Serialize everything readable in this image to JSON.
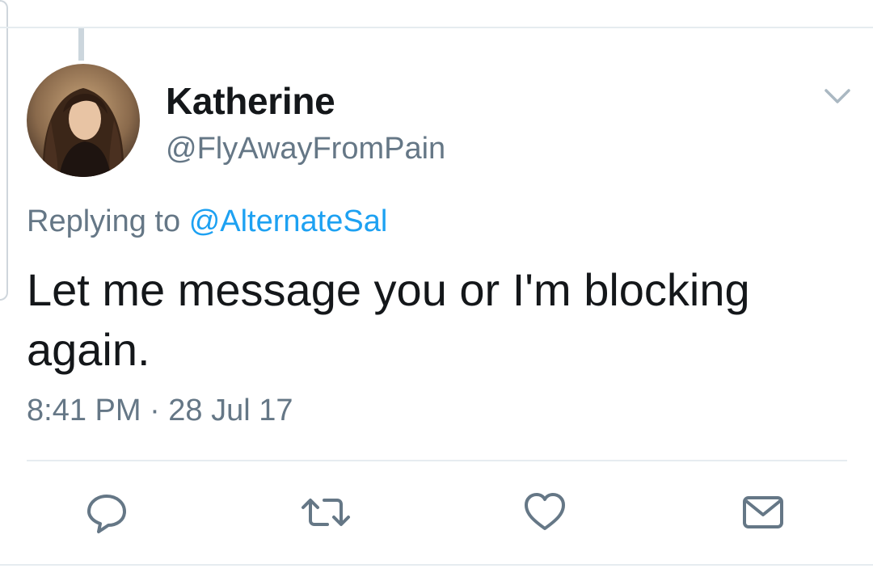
{
  "tweet": {
    "author": {
      "display_name": "Katherine",
      "handle": "@FlyAwayFromPain",
      "avatar_icon": "profile-photo"
    },
    "reply_prefix": "Replying to",
    "reply_to_handle": "@AlternateSal",
    "text": "Let me message you or I'm blocking again.",
    "timestamp": "8:41 PM · 28 Jul 17"
  },
  "actions": [
    {
      "name": "reply",
      "icon": "speech-bubble-icon"
    },
    {
      "name": "retweet",
      "icon": "retweet-icon"
    },
    {
      "name": "like",
      "icon": "heart-icon"
    },
    {
      "name": "direct-message",
      "icon": "envelope-icon"
    }
  ],
  "colors": {
    "text_primary": "#14171a",
    "text_secondary": "#657786",
    "link": "#1da1f2",
    "icon": "#657786",
    "divider": "#e6ecf0"
  }
}
